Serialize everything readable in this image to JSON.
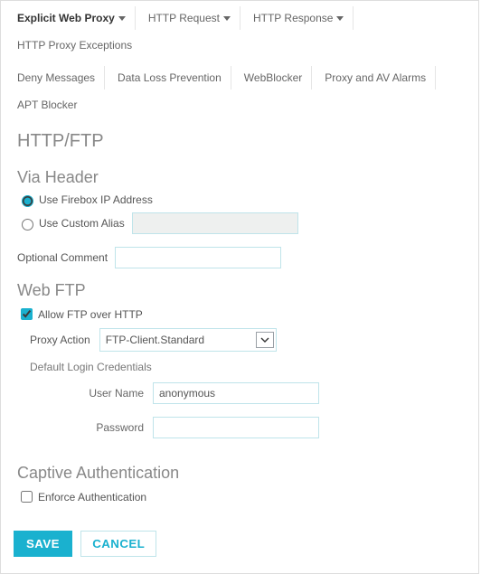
{
  "tabs": {
    "row1": [
      {
        "label": "Explicit Web Proxy",
        "caret": true,
        "active": true
      },
      {
        "label": "HTTP Request",
        "caret": true
      },
      {
        "label": "HTTP Response",
        "caret": true
      },
      {
        "label": "HTTP Proxy Exceptions"
      }
    ],
    "row2": [
      {
        "label": "Deny Messages"
      },
      {
        "label": "Data Loss Prevention"
      },
      {
        "label": "WebBlocker"
      },
      {
        "label": "Proxy and AV Alarms"
      },
      {
        "label": "APT Blocker"
      }
    ]
  },
  "page_title": "HTTP/FTP",
  "via_header": {
    "title": "Via Header",
    "use_firebox_ip_label": "Use Firebox IP Address",
    "use_custom_alias_label": "Use Custom Alias",
    "custom_alias_value": "",
    "optional_comment_label": "Optional Comment",
    "optional_comment_value": "",
    "selected": "firebox"
  },
  "web_ftp": {
    "title": "Web FTP",
    "allow_label": "Allow FTP over HTTP",
    "allow_checked": true,
    "proxy_action_label": "Proxy Action",
    "proxy_action_value": "FTP-Client.Standard",
    "default_login_label": "Default Login Credentials",
    "user_name_label": "User Name",
    "user_name_value": "anonymous",
    "password_label": "Password",
    "password_value": ""
  },
  "captive": {
    "title": "Captive Authentication",
    "enforce_label": "Enforce Authentication",
    "enforce_checked": false
  },
  "buttons": {
    "save": "SAVE",
    "cancel": "CANCEL"
  }
}
